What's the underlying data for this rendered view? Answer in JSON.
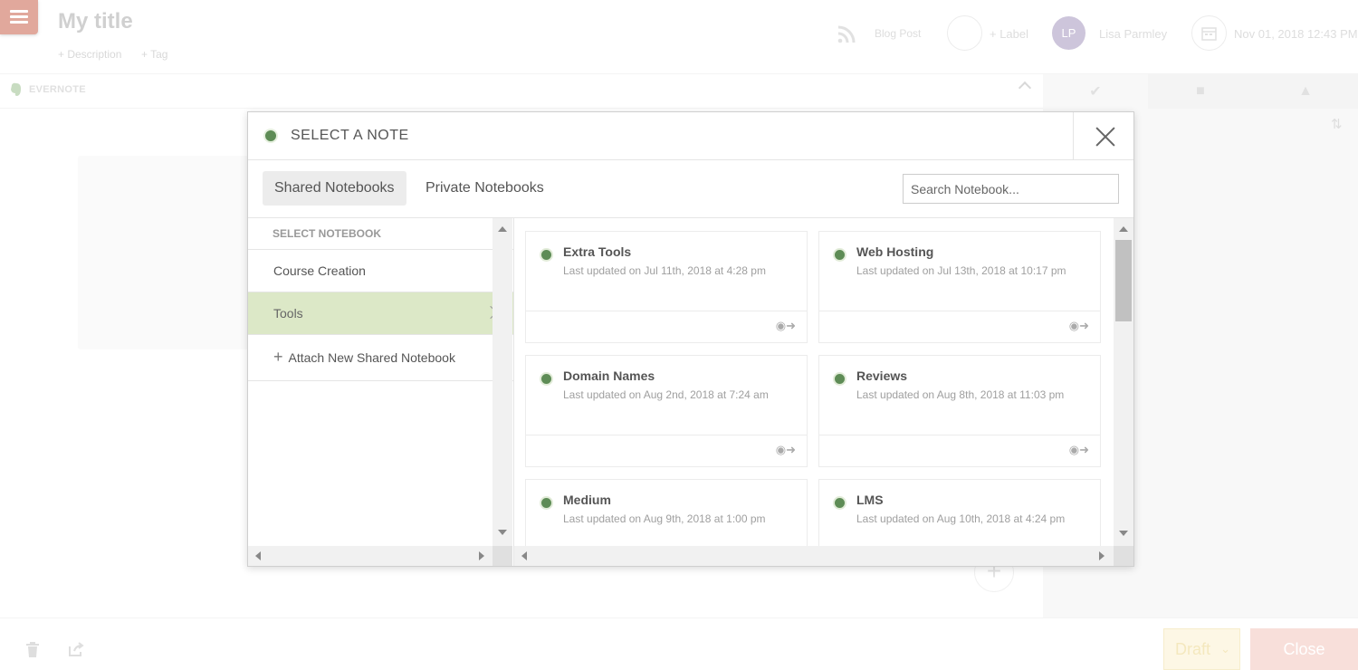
{
  "header": {
    "title": "My title",
    "add_description": "+ Description",
    "add_tag": "+ Tag",
    "post_type": "Blog Post",
    "add_label": "+ Label",
    "avatar_initials": "LP",
    "user_name": "Lisa Parmley",
    "datetime": "Nov 01, 2018 12:43 PM"
  },
  "integration": {
    "label": "EVERNOTE"
  },
  "modal": {
    "title": "SELECT A NOTE",
    "tabs": [
      {
        "label": "Shared Notebooks",
        "active": true
      },
      {
        "label": "Private Notebooks",
        "active": false
      }
    ],
    "search": {
      "placeholder": "Search Notebook...",
      "value": ""
    },
    "notebooks": {
      "heading": "SELECT NOTEBOOK",
      "items": [
        {
          "label": "Course Creation",
          "selected": false
        },
        {
          "label": "Tools",
          "selected": true
        }
      ],
      "attach_label": "Attach New Shared Notebook"
    },
    "notes": [
      {
        "title": "Extra Tools",
        "updated": "Last updated on Jul 11th, 2018 at 4:28 pm"
      },
      {
        "title": "Web Hosting",
        "updated": "Last updated on Jul 13th, 2018 at 10:17 pm"
      },
      {
        "title": "Domain Names",
        "updated": "Last updated on Aug 2nd, 2018 at 7:24 am"
      },
      {
        "title": "Reviews",
        "updated": "Last updated on Aug 8th, 2018 at 11:03 pm"
      },
      {
        "title": "Medium",
        "updated": "Last updated on Aug 9th, 2018 at 1:00 pm"
      },
      {
        "title": "LMS",
        "updated": "Last updated on Aug 10th, 2018 at 4:24 pm"
      }
    ]
  },
  "footer": {
    "draft_label": "Draft",
    "close_label": "Close"
  },
  "colors": {
    "brand_red": "#c9624b",
    "evernote_green": "#5e8c56",
    "selected_bg": "#dce8c7"
  },
  "icons": {
    "note": "evernote-icon",
    "open_note": "evernote-open-icon"
  }
}
